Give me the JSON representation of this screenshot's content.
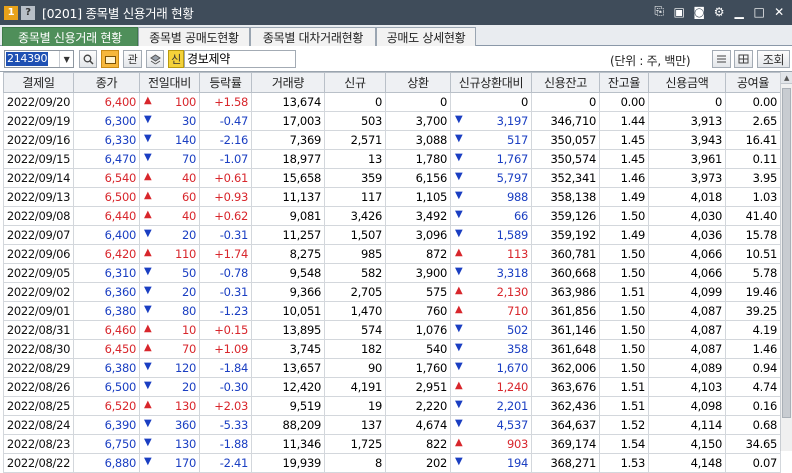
{
  "window": {
    "badge": "1",
    "help": "?",
    "title": "[0201] 종목별 신용거래 현황"
  },
  "tabs": [
    "종목별 신용거래 현황",
    "종목별 공매도현황",
    "종목별 대차거래현황",
    "공매도 상세현황"
  ],
  "toolbar": {
    "code": "214390",
    "owner_button": "관",
    "credit_badge": "신",
    "stock_name": "경보제약",
    "unit": "(단위 : 주, 백만)",
    "query_button": "조회"
  },
  "colors": {
    "up": "#d8262c",
    "down": "#1a3ec2",
    "active_tab": "#4f8f5a",
    "titlebar": "#3f4c5a"
  },
  "table": {
    "headers": [
      "결제일",
      "종가",
      "전일대비",
      "등락률",
      "거래량",
      "신규",
      "상환",
      "신규상환대비",
      "신용잔고",
      "잔고율",
      "신용금액",
      "공여율"
    ],
    "rows": [
      {
        "date": "2022/09/20",
        "close": "6,400",
        "dir": "up",
        "chg": "100",
        "rate": "+1.58",
        "vol": "13,674",
        "new": "0",
        "repay": "0",
        "ndir": "",
        "ndiff": "0",
        "bal": "0",
        "ratio": "0.00",
        "amt": "0",
        "grant": "0.00"
      },
      {
        "date": "2022/09/19",
        "close": "6,300",
        "dir": "down",
        "chg": "30",
        "rate": "-0.47",
        "vol": "17,003",
        "new": "503",
        "repay": "3,700",
        "ndir": "down",
        "ndiff": "3,197",
        "bal": "346,710",
        "ratio": "1.44",
        "amt": "3,913",
        "grant": "2.65"
      },
      {
        "date": "2022/09/16",
        "close": "6,330",
        "dir": "down",
        "chg": "140",
        "rate": "-2.16",
        "vol": "7,369",
        "new": "2,571",
        "repay": "3,088",
        "ndir": "down",
        "ndiff": "517",
        "bal": "350,057",
        "ratio": "1.45",
        "amt": "3,943",
        "grant": "16.41"
      },
      {
        "date": "2022/09/15",
        "close": "6,470",
        "dir": "down",
        "chg": "70",
        "rate": "-1.07",
        "vol": "18,977",
        "new": "13",
        "repay": "1,780",
        "ndir": "down",
        "ndiff": "1,767",
        "bal": "350,574",
        "ratio": "1.45",
        "amt": "3,961",
        "grant": "0.11"
      },
      {
        "date": "2022/09/14",
        "close": "6,540",
        "dir": "up",
        "chg": "40",
        "rate": "+0.61",
        "vol": "15,658",
        "new": "359",
        "repay": "6,156",
        "ndir": "down",
        "ndiff": "5,797",
        "bal": "352,341",
        "ratio": "1.46",
        "amt": "3,973",
        "grant": "3.95"
      },
      {
        "date": "2022/09/13",
        "close": "6,500",
        "dir": "up",
        "chg": "60",
        "rate": "+0.93",
        "vol": "11,137",
        "new": "117",
        "repay": "1,105",
        "ndir": "down",
        "ndiff": "988",
        "bal": "358,138",
        "ratio": "1.49",
        "amt": "4,018",
        "grant": "1.03"
      },
      {
        "date": "2022/09/08",
        "close": "6,440",
        "dir": "up",
        "chg": "40",
        "rate": "+0.62",
        "vol": "9,081",
        "new": "3,426",
        "repay": "3,492",
        "ndir": "down",
        "ndiff": "66",
        "bal": "359,126",
        "ratio": "1.50",
        "amt": "4,030",
        "grant": "41.40"
      },
      {
        "date": "2022/09/07",
        "close": "6,400",
        "dir": "down",
        "chg": "20",
        "rate": "-0.31",
        "vol": "11,257",
        "new": "1,507",
        "repay": "3,096",
        "ndir": "down",
        "ndiff": "1,589",
        "bal": "359,192",
        "ratio": "1.49",
        "amt": "4,036",
        "grant": "15.78"
      },
      {
        "date": "2022/09/06",
        "close": "6,420",
        "dir": "up",
        "chg": "110",
        "rate": "+1.74",
        "vol": "8,275",
        "new": "985",
        "repay": "872",
        "ndir": "up",
        "ndiff": "113",
        "bal": "360,781",
        "ratio": "1.50",
        "amt": "4,066",
        "grant": "10.51"
      },
      {
        "date": "2022/09/05",
        "close": "6,310",
        "dir": "down",
        "chg": "50",
        "rate": "-0.78",
        "vol": "9,548",
        "new": "582",
        "repay": "3,900",
        "ndir": "down",
        "ndiff": "3,318",
        "bal": "360,668",
        "ratio": "1.50",
        "amt": "4,066",
        "grant": "5.78"
      },
      {
        "date": "2022/09/02",
        "close": "6,360",
        "dir": "down",
        "chg": "20",
        "rate": "-0.31",
        "vol": "9,366",
        "new": "2,705",
        "repay": "575",
        "ndir": "up",
        "ndiff": "2,130",
        "bal": "363,986",
        "ratio": "1.51",
        "amt": "4,099",
        "grant": "19.46"
      },
      {
        "date": "2022/09/01",
        "close": "6,380",
        "dir": "down",
        "chg": "80",
        "rate": "-1.23",
        "vol": "10,051",
        "new": "1,470",
        "repay": "760",
        "ndir": "up",
        "ndiff": "710",
        "bal": "361,856",
        "ratio": "1.50",
        "amt": "4,087",
        "grant": "39.25"
      },
      {
        "date": "2022/08/31",
        "close": "6,460",
        "dir": "up",
        "chg": "10",
        "rate": "+0.15",
        "vol": "13,895",
        "new": "574",
        "repay": "1,076",
        "ndir": "down",
        "ndiff": "502",
        "bal": "361,146",
        "ratio": "1.50",
        "amt": "4,087",
        "grant": "4.19"
      },
      {
        "date": "2022/08/30",
        "close": "6,450",
        "dir": "up",
        "chg": "70",
        "rate": "+1.09",
        "vol": "3,745",
        "new": "182",
        "repay": "540",
        "ndir": "down",
        "ndiff": "358",
        "bal": "361,648",
        "ratio": "1.50",
        "amt": "4,087",
        "grant": "1.46"
      },
      {
        "date": "2022/08/29",
        "close": "6,380",
        "dir": "down",
        "chg": "120",
        "rate": "-1.84",
        "vol": "13,657",
        "new": "90",
        "repay": "1,760",
        "ndir": "down",
        "ndiff": "1,670",
        "bal": "362,006",
        "ratio": "1.50",
        "amt": "4,089",
        "grant": "0.94"
      },
      {
        "date": "2022/08/26",
        "close": "6,500",
        "dir": "down",
        "chg": "20",
        "rate": "-0.30",
        "vol": "12,420",
        "new": "4,191",
        "repay": "2,951",
        "ndir": "up",
        "ndiff": "1,240",
        "bal": "363,676",
        "ratio": "1.51",
        "amt": "4,103",
        "grant": "4.74"
      },
      {
        "date": "2022/08/25",
        "close": "6,520",
        "dir": "up",
        "chg": "130",
        "rate": "+2.03",
        "vol": "9,519",
        "new": "19",
        "repay": "2,220",
        "ndir": "down",
        "ndiff": "2,201",
        "bal": "362,436",
        "ratio": "1.51",
        "amt": "4,098",
        "grant": "0.16"
      },
      {
        "date": "2022/08/24",
        "close": "6,390",
        "dir": "down",
        "chg": "360",
        "rate": "-5.33",
        "vol": "88,209",
        "new": "137",
        "repay": "4,674",
        "ndir": "down",
        "ndiff": "4,537",
        "bal": "364,637",
        "ratio": "1.52",
        "amt": "4,114",
        "grant": "0.68"
      },
      {
        "date": "2022/08/23",
        "close": "6,750",
        "dir": "down",
        "chg": "130",
        "rate": "-1.88",
        "vol": "11,346",
        "new": "1,725",
        "repay": "822",
        "ndir": "up",
        "ndiff": "903",
        "bal": "369,174",
        "ratio": "1.54",
        "amt": "4,150",
        "grant": "34.65"
      },
      {
        "date": "2022/08/22",
        "close": "6,880",
        "dir": "down",
        "chg": "170",
        "rate": "-2.41",
        "vol": "19,939",
        "new": "8",
        "repay": "202",
        "ndir": "down",
        "ndiff": "194",
        "bal": "368,271",
        "ratio": "1.53",
        "amt": "4,148",
        "grant": "0.07"
      }
    ]
  }
}
